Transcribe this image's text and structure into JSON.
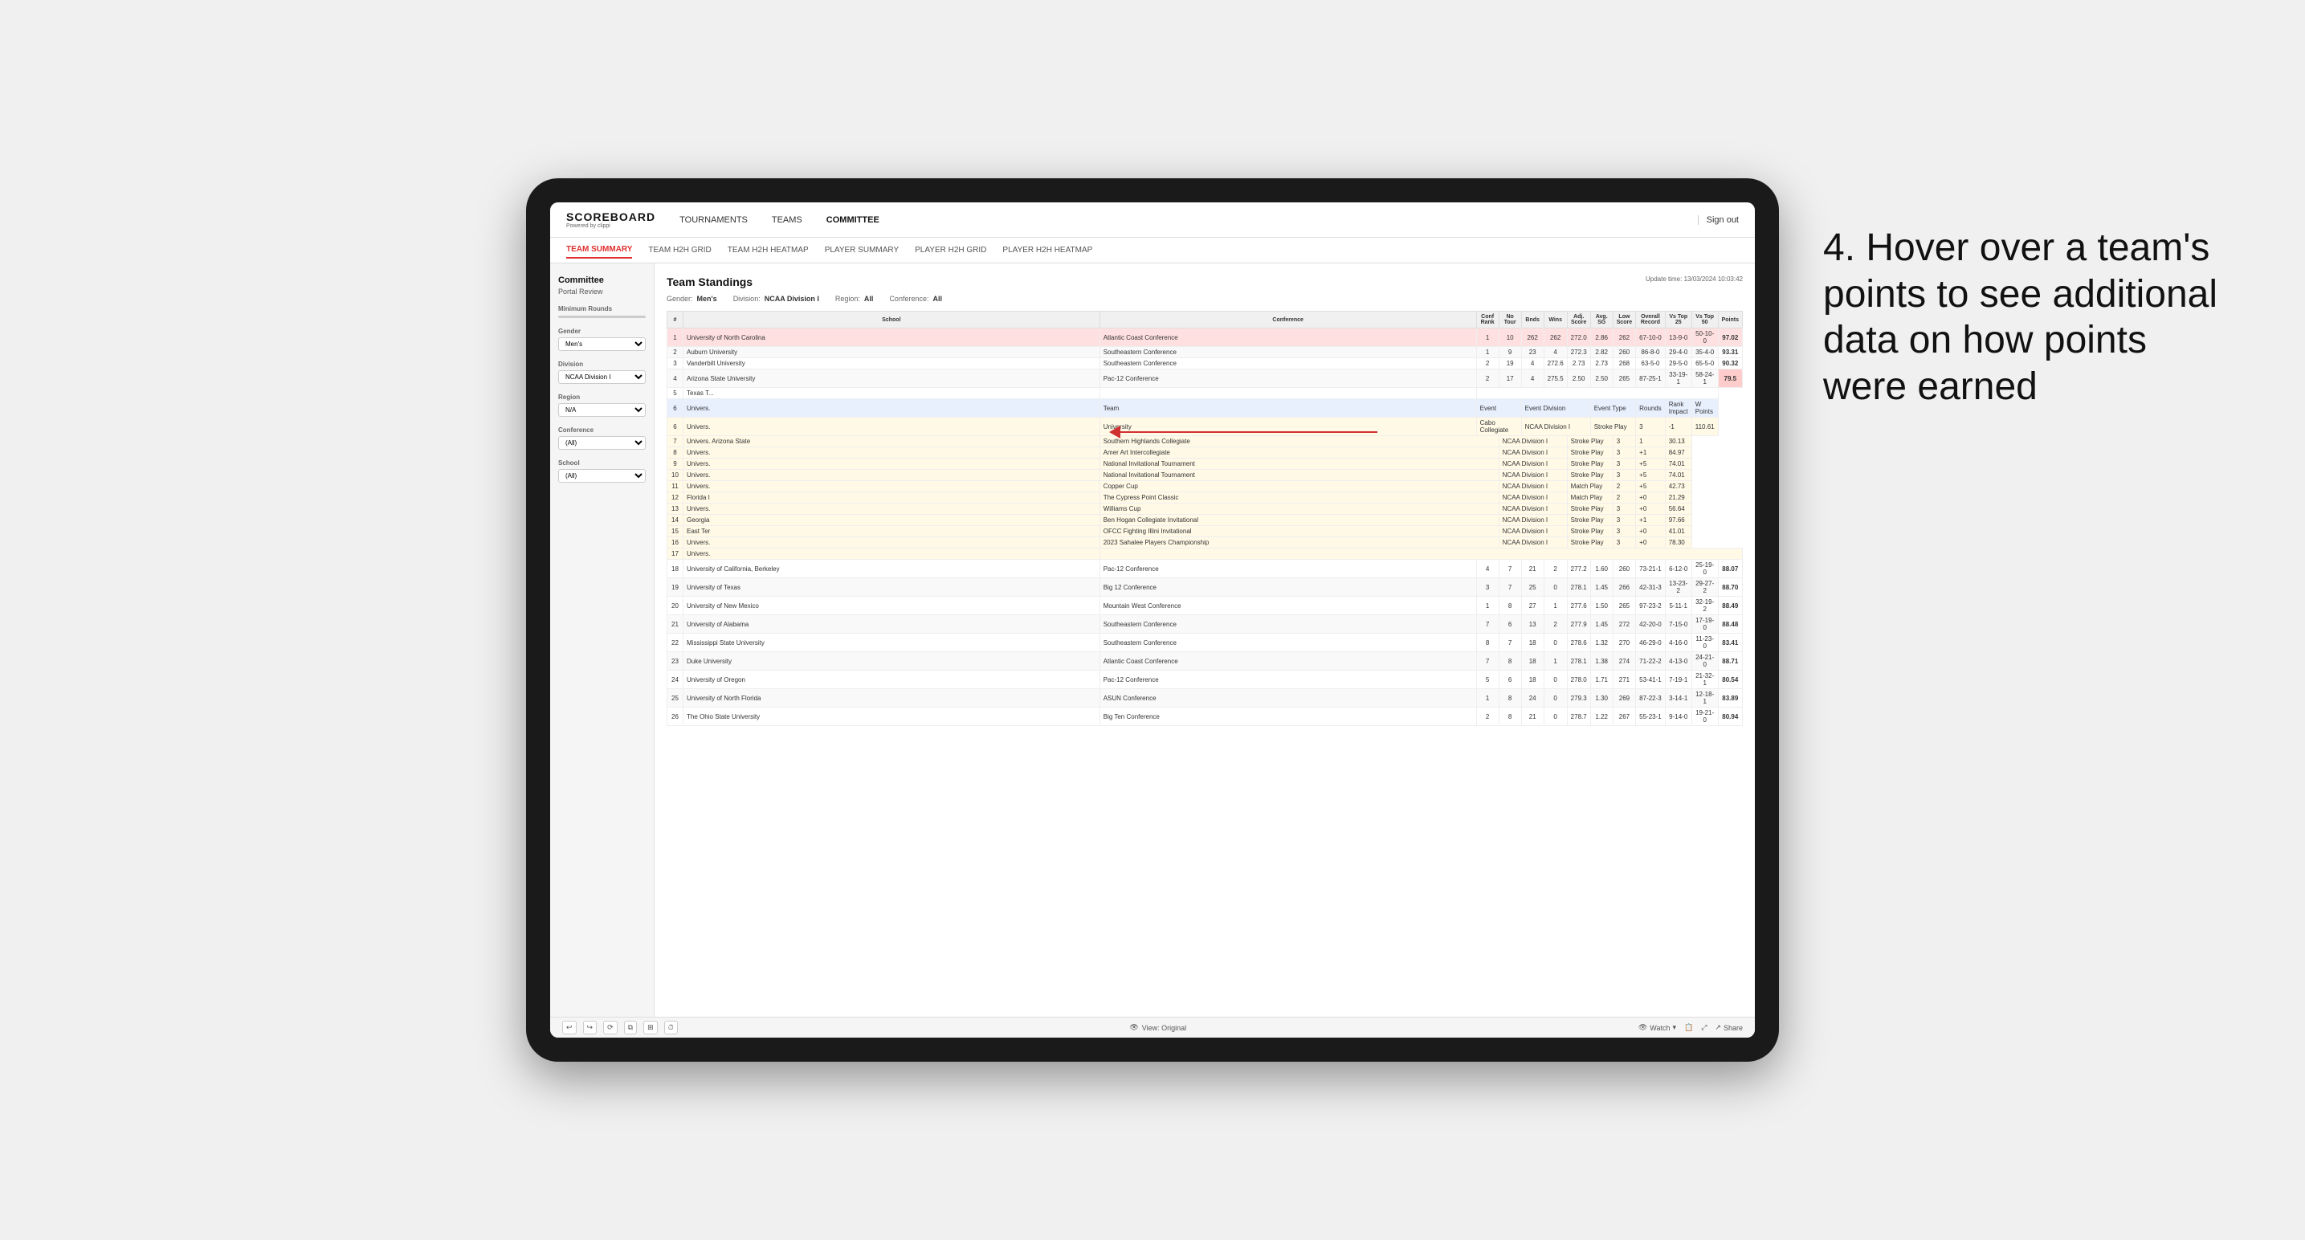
{
  "app": {
    "logo": "SCOREBOARD",
    "logo_sub": "Powered by clippi",
    "nav_links": [
      "TOURNAMENTS",
      "TEAMS",
      "COMMITTEE"
    ],
    "sign_out": "Sign out"
  },
  "sub_nav": {
    "tabs": [
      "TEAM SUMMARY",
      "TEAM H2H GRID",
      "TEAM H2H HEATMAP",
      "PLAYER SUMMARY",
      "PLAYER H2H GRID",
      "PLAYER H2H HEATMAP"
    ],
    "active": "TEAM SUMMARY"
  },
  "sidebar": {
    "title": "Committee",
    "subtitle": "Portal Review",
    "sections": [
      {
        "label": "Minimum Rounds",
        "type": "range"
      },
      {
        "label": "Gender",
        "value": "Men's",
        "type": "select"
      },
      {
        "label": "Division",
        "value": "NCAA Division I",
        "type": "select"
      },
      {
        "label": "Region",
        "value": "N/A",
        "type": "select"
      },
      {
        "label": "Conference",
        "value": "(All)",
        "type": "select"
      },
      {
        "label": "School",
        "value": "(All)",
        "type": "select"
      }
    ]
  },
  "report": {
    "title": "Team Standings",
    "update_time": "Update time:",
    "update_datetime": "13/03/2024 10:03:42",
    "filters": {
      "gender": {
        "label": "Gender:",
        "value": "Men's"
      },
      "division": {
        "label": "Division:",
        "value": "NCAA Division I"
      },
      "region": {
        "label": "Region:",
        "value": "All"
      },
      "conference": {
        "label": "Conference:",
        "value": "All"
      }
    },
    "table_headers": [
      "#",
      "School",
      "Conference",
      "Conf Rank",
      "No Tour",
      "Bnds",
      "Wins",
      "Adj. Score",
      "Avg. SG",
      "Low Score",
      "Overall Record",
      "Vs Top 25",
      "Vs Top 50",
      "Points"
    ],
    "rows": [
      {
        "rank": 1,
        "school": "University of North Carolina",
        "conference": "Atlantic Coast Conference",
        "conf_rank": 1,
        "no_tour": 10,
        "bnds": 262,
        "wins": 262,
        "adj_score": 272.0,
        "avg_sg": 2.86,
        "low_score": 262,
        "overall_record": "67-10-0",
        "vs_top25": "13-9-0",
        "vs_top50": "50-10-0",
        "points": 97.02,
        "highlighted": true
      },
      {
        "rank": 2,
        "school": "Auburn University",
        "conference": "Southeastern Conference",
        "conf_rank": 1,
        "no_tour": 9,
        "bnds": 23,
        "wins": 4,
        "adj_score": 272.3,
        "avg_sg": 2.82,
        "low_score": 260,
        "overall_record": "86-8-0",
        "vs_top25": "29-4-0",
        "vs_top50": "35-4-0",
        "points": 93.31,
        "highlighted": false
      },
      {
        "rank": 3,
        "school": "Vanderbilt University",
        "conference": "Southeastern Conference",
        "conf_rank": 2,
        "no_tour": 19,
        "bnds": 4,
        "wins": 272.6,
        "adj_score": 2.73,
        "avg_sg": 2.73,
        "low_score": 268,
        "overall_record": "63-5-0",
        "vs_top25": "29-5-0",
        "vs_top50": "65-5-0",
        "points": 90.32,
        "highlighted": false
      },
      {
        "rank": 4,
        "school": "Arizona State University",
        "conference": "Pac-12 Conference",
        "conf_rank": 2,
        "no_tour": 17,
        "bnds": 4,
        "wins": 275.5,
        "adj_score": 2.5,
        "avg_sg": 2.5,
        "low_score": 265,
        "overall_record": "87-25-1",
        "vs_top25": "33-19-1",
        "vs_top50": "58-24-1",
        "points": 79.5,
        "highlighted": false
      },
      {
        "rank": 5,
        "school": "Texas T...",
        "conference": "",
        "conf_rank": null,
        "no_tour": null,
        "bnds": null,
        "wins": null,
        "adj_score": null,
        "avg_sg": null,
        "low_score": null,
        "overall_record": "",
        "vs_top25": "",
        "vs_top50": "",
        "points": null,
        "highlighted": false
      }
    ],
    "tooltip_section": {
      "team": "University",
      "team_full": "University",
      "event_header": "Event",
      "rows": [
        {
          "rank": 6,
          "school": "Univers.",
          "event": "Cabo Collegiate",
          "event_division": "NCAA Division I",
          "event_type": "Stroke Play",
          "rounds": 3,
          "rank_impact": -1,
          "w_points": 110.61
        },
        {
          "rank": 7,
          "school": "Univers. Arizona State University",
          "event": "Southern Highlands Collegiate",
          "event_division": "NCAA Division I",
          "event_type": "Stroke Play",
          "rounds": 3,
          "rank_impact": 1,
          "w_points": 30.13
        },
        {
          "rank": 8,
          "school": "Univers.",
          "event": "Amer Art Intercollegiate",
          "event_division": "NCAA Division I",
          "event_type": "Stroke Play",
          "rounds": 3,
          "rank_impact": 1,
          "w_points": 84.97
        },
        {
          "rank": 9,
          "school": "Univers.",
          "event": "National Invitational Tournament",
          "event_division": "NCAA Division I",
          "event_type": "Stroke Play",
          "rounds": 3,
          "rank_impact": 5,
          "w_points": 74.01
        },
        {
          "rank": 10,
          "school": "Univers.",
          "event": "National Invitational Tournament",
          "event_division": "NCAA Division I",
          "event_type": "Stroke Play",
          "rounds": 3,
          "rank_impact": 5,
          "w_points": 74.01
        },
        {
          "rank": 11,
          "school": "Univers.",
          "event": "Copper Cup",
          "event_division": "NCAA Division I",
          "event_type": "Match Play",
          "rounds": 2,
          "rank_impact": 5,
          "w_points": 42.73
        },
        {
          "rank": 12,
          "school": "Florida I",
          "event": "The Cypress Point Classic",
          "event_division": "NCAA Division I",
          "event_type": "Match Play",
          "rounds": 2,
          "rank_impact": 0,
          "w_points": 21.29
        },
        {
          "rank": 13,
          "school": "Univers.",
          "event": "Williams Cup",
          "event_division": "NCAA Division I",
          "event_type": "Stroke Play",
          "rounds": 3,
          "rank_impact": 0,
          "w_points": 56.64
        },
        {
          "rank": 14,
          "school": "Georgia",
          "event": "Ben Hogan Collegiate Invitational",
          "event_division": "NCAA Division I",
          "event_type": "Stroke Play",
          "rounds": 3,
          "rank_impact": 1,
          "w_points": 97.66
        },
        {
          "rank": 15,
          "school": "East Ter",
          "event": "OFCC Fighting Illini Invitational",
          "event_division": "NCAA Division I",
          "event_type": "Stroke Play",
          "rounds": 3,
          "rank_impact": 0,
          "w_points": 41.01
        },
        {
          "rank": 16,
          "school": "Univers.",
          "event": "2023 Sahalee Players Championship",
          "event_division": "NCAA Division I",
          "event_type": "Stroke Play",
          "rounds": 3,
          "rank_impact": 0,
          "w_points": 78.3
        },
        {
          "rank": 17,
          "school": "Univers.",
          "event": "",
          "event_division": "",
          "event_type": "",
          "rounds": null,
          "rank_impact": null,
          "w_points": null
        }
      ]
    },
    "main_rows": [
      {
        "rank": 18,
        "school": "University of California, Berkeley",
        "conference": "Pac-12 Conference",
        "conf_rank": 4,
        "no_tour": 7,
        "bnds": 21,
        "wins": 2,
        "adj_score": 277.2,
        "avg_sg": 1.6,
        "low_score": 260,
        "overall_record": "73-21-1",
        "vs_top25": "6-12-0",
        "vs_top50": "25-19-0",
        "points": 88.07
      },
      {
        "rank": 19,
        "school": "University of Texas",
        "conference": "Big 12 Conference",
        "conf_rank": 3,
        "no_tour": 7,
        "bnds": 25,
        "wins": 0,
        "adj_score": 278.1,
        "avg_sg": 1.45,
        "low_score": 266,
        "overall_record": "42-31-3",
        "vs_top25": "13-23-2",
        "vs_top50": "29-27-2",
        "points": 88.7
      },
      {
        "rank": 20,
        "school": "University of New Mexico",
        "conference": "Mountain West Conference",
        "conf_rank": 1,
        "no_tour": 8,
        "bnds": 27,
        "wins": 1,
        "adj_score": 277.6,
        "avg_sg": 1.5,
        "low_score": 265,
        "overall_record": "97-23-2",
        "vs_top25": "5-11-1",
        "vs_top50": "32-19-2",
        "points": 88.49
      },
      {
        "rank": 21,
        "school": "University of Alabama",
        "conference": "Southeastern Conference",
        "conf_rank": 7,
        "no_tour": 6,
        "bnds": 13,
        "wins": 2,
        "adj_score": 277.9,
        "avg_sg": 1.45,
        "low_score": 272,
        "overall_record": "42-20-0",
        "vs_top25": "7-15-0",
        "vs_top50": "17-19-0",
        "points": 88.48
      },
      {
        "rank": 22,
        "school": "Mississippi State University",
        "conference": "Southeastern Conference",
        "conf_rank": 8,
        "no_tour": 7,
        "bnds": 18,
        "wins": 0,
        "adj_score": 278.6,
        "avg_sg": 1.32,
        "low_score": 270,
        "overall_record": "46-29-0",
        "vs_top25": "4-16-0",
        "vs_top50": "11-23-0",
        "points": 83.41
      },
      {
        "rank": 23,
        "school": "Duke University",
        "conference": "Atlantic Coast Conference",
        "conf_rank": 7,
        "no_tour": 8,
        "bnds": 18,
        "wins": 1,
        "adj_score": 278.1,
        "avg_sg": 1.38,
        "low_score": 274,
        "overall_record": "71-22-2",
        "vs_top25": "4-13-0",
        "vs_top50": "24-21-0",
        "points": 88.71
      },
      {
        "rank": 24,
        "school": "University of Oregon",
        "conference": "Pac-12 Conference",
        "conf_rank": 5,
        "no_tour": 6,
        "bnds": 18,
        "wins": 0,
        "adj_score": 278.0,
        "avg_sg": 1.71,
        "low_score": 271,
        "overall_record": "53-41-1",
        "vs_top25": "7-19-1",
        "vs_top50": "21-32-1",
        "points": 80.54
      },
      {
        "rank": 25,
        "school": "University of North Florida",
        "conference": "ASUN Conference",
        "conf_rank": 1,
        "no_tour": 8,
        "bnds": 24,
        "wins": 0,
        "adj_score": 279.3,
        "avg_sg": 1.3,
        "low_score": 269,
        "overall_record": "87-22-3",
        "vs_top25": "3-14-1",
        "vs_top50": "12-18-1",
        "points": 83.89
      },
      {
        "rank": 26,
        "school": "The Ohio State University",
        "conference": "Big Ten Conference",
        "conf_rank": 2,
        "no_tour": 8,
        "bnds": 21,
        "wins": 0,
        "adj_score": 278.7,
        "avg_sg": 1.22,
        "low_score": 267,
        "overall_record": "55-23-1",
        "vs_top25": "9-14-0",
        "vs_top50": "19-21-0",
        "points": 80.94
      }
    ]
  },
  "toolbar": {
    "view_label": "View: Original",
    "watch_label": "Watch",
    "share_label": "Share"
  },
  "annotation": {
    "text": "4. Hover over a team's points to see additional data on how points were earned"
  }
}
